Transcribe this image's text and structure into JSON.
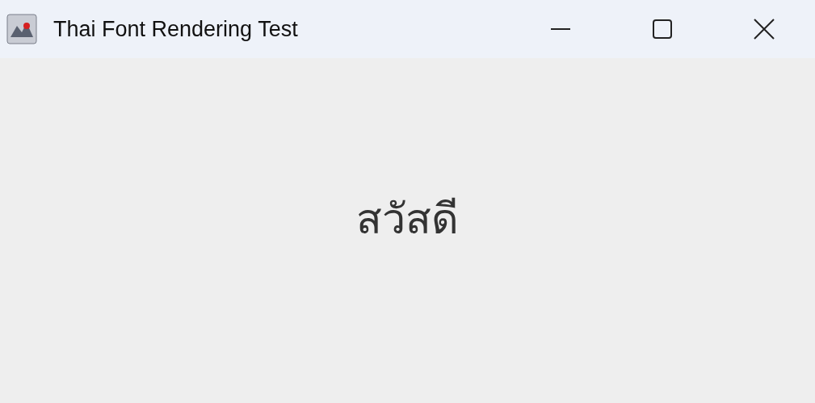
{
  "window": {
    "title": "Thai Font Rendering Test"
  },
  "content": {
    "label": "สวัสดี"
  }
}
